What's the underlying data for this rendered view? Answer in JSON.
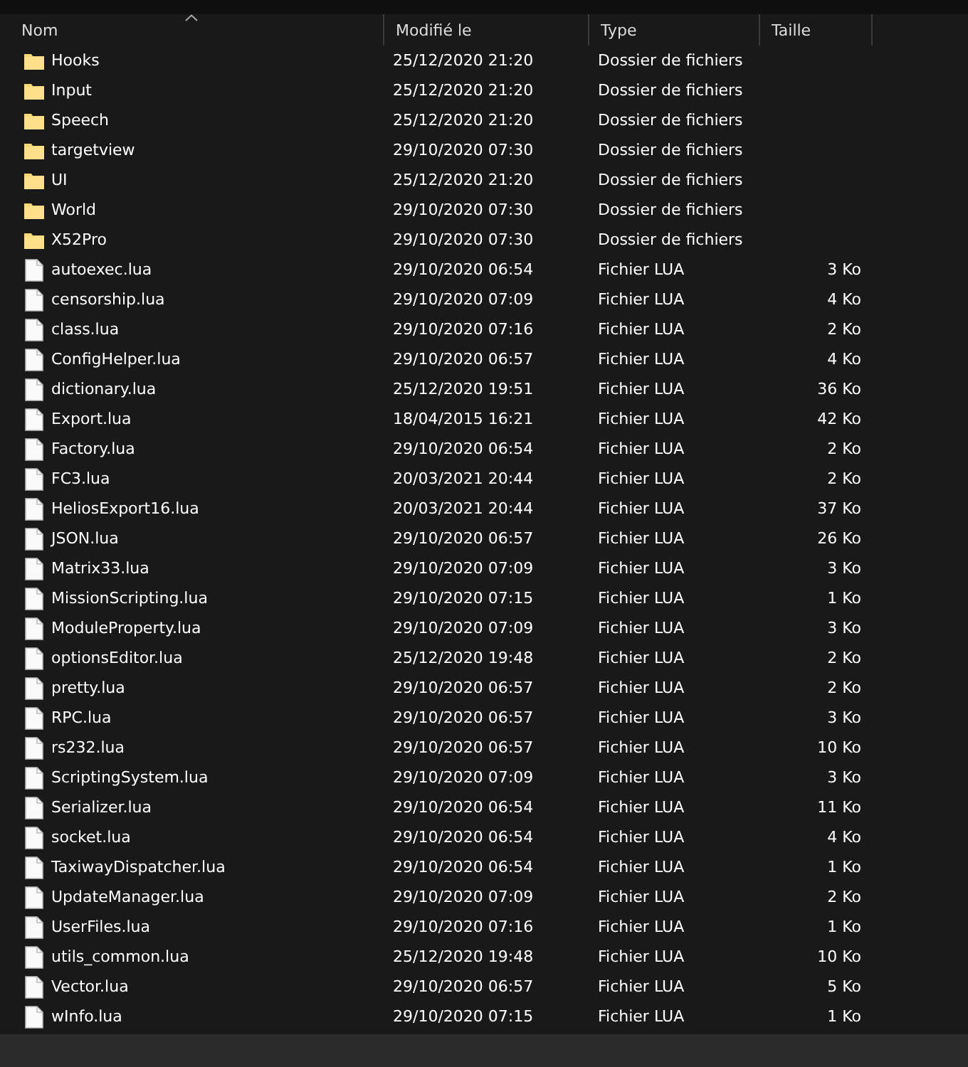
{
  "columns": [
    {
      "label": "Nom",
      "sorted": true
    },
    {
      "label": "Modifié le",
      "sorted": false
    },
    {
      "label": "Type",
      "sorted": false
    },
    {
      "label": "Taille",
      "sorted": false
    }
  ],
  "rows": [
    {
      "kind": "folder",
      "name": "Hooks",
      "modified": "25/12/2020 21:20",
      "type": "Dossier de fichiers",
      "size": ""
    },
    {
      "kind": "folder",
      "name": "Input",
      "modified": "25/12/2020 21:20",
      "type": "Dossier de fichiers",
      "size": ""
    },
    {
      "kind": "folder",
      "name": "Speech",
      "modified": "25/12/2020 21:20",
      "type": "Dossier de fichiers",
      "size": ""
    },
    {
      "kind": "folder",
      "name": "targetview",
      "modified": "29/10/2020 07:30",
      "type": "Dossier de fichiers",
      "size": ""
    },
    {
      "kind": "folder",
      "name": "UI",
      "modified": "25/12/2020 21:20",
      "type": "Dossier de fichiers",
      "size": ""
    },
    {
      "kind": "folder",
      "name": "World",
      "modified": "29/10/2020 07:30",
      "type": "Dossier de fichiers",
      "size": ""
    },
    {
      "kind": "folder",
      "name": "X52Pro",
      "modified": "29/10/2020 07:30",
      "type": "Dossier de fichiers",
      "size": ""
    },
    {
      "kind": "file",
      "name": "autoexec.lua",
      "modified": "29/10/2020 06:54",
      "type": "Fichier LUA",
      "size": "3 Ko"
    },
    {
      "kind": "file",
      "name": "censorship.lua",
      "modified": "29/10/2020 07:09",
      "type": "Fichier LUA",
      "size": "4 Ko"
    },
    {
      "kind": "file",
      "name": "class.lua",
      "modified": "29/10/2020 07:16",
      "type": "Fichier LUA",
      "size": "2 Ko"
    },
    {
      "kind": "file",
      "name": "ConfigHelper.lua",
      "modified": "29/10/2020 06:57",
      "type": "Fichier LUA",
      "size": "4 Ko"
    },
    {
      "kind": "file",
      "name": "dictionary.lua",
      "modified": "25/12/2020 19:51",
      "type": "Fichier LUA",
      "size": "36 Ko"
    },
    {
      "kind": "file",
      "name": "Export.lua",
      "modified": "18/04/2015 16:21",
      "type": "Fichier LUA",
      "size": "42 Ko"
    },
    {
      "kind": "file",
      "name": "Factory.lua",
      "modified": "29/10/2020 06:54",
      "type": "Fichier LUA",
      "size": "2 Ko"
    },
    {
      "kind": "file",
      "name": "FC3.lua",
      "modified": "20/03/2021 20:44",
      "type": "Fichier LUA",
      "size": "2 Ko"
    },
    {
      "kind": "file",
      "name": "HeliosExport16.lua",
      "modified": "20/03/2021 20:44",
      "type": "Fichier LUA",
      "size": "37 Ko"
    },
    {
      "kind": "file",
      "name": "JSON.lua",
      "modified": "29/10/2020 06:57",
      "type": "Fichier LUA",
      "size": "26 Ko"
    },
    {
      "kind": "file",
      "name": "Matrix33.lua",
      "modified": "29/10/2020 07:09",
      "type": "Fichier LUA",
      "size": "3 Ko"
    },
    {
      "kind": "file",
      "name": "MissionScripting.lua",
      "modified": "29/10/2020 07:15",
      "type": "Fichier LUA",
      "size": "1 Ko"
    },
    {
      "kind": "file",
      "name": "ModuleProperty.lua",
      "modified": "29/10/2020 07:09",
      "type": "Fichier LUA",
      "size": "3 Ko"
    },
    {
      "kind": "file",
      "name": "optionsEditor.lua",
      "modified": "25/12/2020 19:48",
      "type": "Fichier LUA",
      "size": "2 Ko"
    },
    {
      "kind": "file",
      "name": "pretty.lua",
      "modified": "29/10/2020 06:57",
      "type": "Fichier LUA",
      "size": "2 Ko"
    },
    {
      "kind": "file",
      "name": "RPC.lua",
      "modified": "29/10/2020 06:57",
      "type": "Fichier LUA",
      "size": "3 Ko"
    },
    {
      "kind": "file",
      "name": "rs232.lua",
      "modified": "29/10/2020 06:57",
      "type": "Fichier LUA",
      "size": "10 Ko"
    },
    {
      "kind": "file",
      "name": "ScriptingSystem.lua",
      "modified": "29/10/2020 07:09",
      "type": "Fichier LUA",
      "size": "3 Ko"
    },
    {
      "kind": "file",
      "name": "Serializer.lua",
      "modified": "29/10/2020 06:54",
      "type": "Fichier LUA",
      "size": "11 Ko"
    },
    {
      "kind": "file",
      "name": "socket.lua",
      "modified": "29/10/2020 06:54",
      "type": "Fichier LUA",
      "size": "4 Ko"
    },
    {
      "kind": "file",
      "name": "TaxiwayDispatcher.lua",
      "modified": "29/10/2020 06:54",
      "type": "Fichier LUA",
      "size": "1 Ko"
    },
    {
      "kind": "file",
      "name": "UpdateManager.lua",
      "modified": "29/10/2020 07:09",
      "type": "Fichier LUA",
      "size": "2 Ko"
    },
    {
      "kind": "file",
      "name": "UserFiles.lua",
      "modified": "29/10/2020 07:16",
      "type": "Fichier LUA",
      "size": "1 Ko"
    },
    {
      "kind": "file",
      "name": "utils_common.lua",
      "modified": "25/12/2020 19:48",
      "type": "Fichier LUA",
      "size": "10 Ko"
    },
    {
      "kind": "file",
      "name": "Vector.lua",
      "modified": "29/10/2020 06:57",
      "type": "Fichier LUA",
      "size": "5 Ko"
    },
    {
      "kind": "file",
      "name": "wInfo.lua",
      "modified": "29/10/2020 07:15",
      "type": "Fichier LUA",
      "size": "1 Ko"
    }
  ]
}
